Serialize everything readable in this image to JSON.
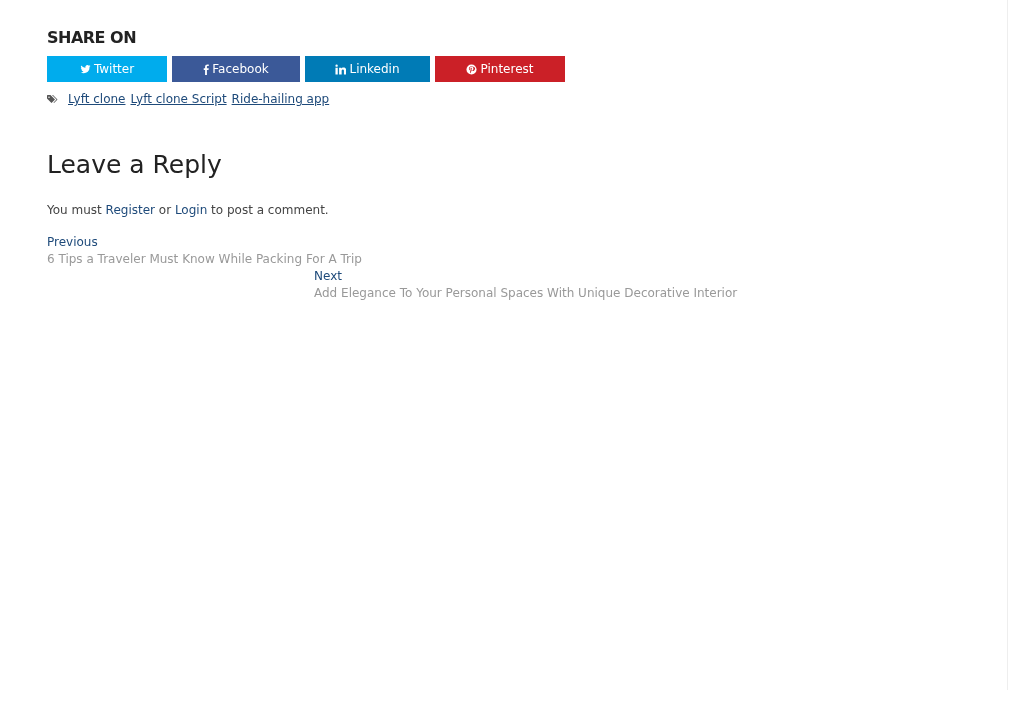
{
  "share": {
    "heading": "SHARE ON",
    "buttons": [
      {
        "kind": "twitter",
        "label": "Twitter",
        "color": "#00aced"
      },
      {
        "kind": "facebook",
        "label": "Facebook",
        "color": "#3b5998"
      },
      {
        "kind": "linkedin",
        "label": "Linkedin",
        "color": "#007bb6"
      },
      {
        "kind": "pinterest",
        "label": "Pinterest",
        "color": "#cb2027"
      }
    ]
  },
  "tags": [
    "Lyft clone",
    "Lyft clone Script",
    "Ride-hailing app"
  ],
  "reply": {
    "title": "Leave a Reply",
    "notice": {
      "before": "You must",
      "register": "Register",
      "middle": "or",
      "login": "Login",
      "after": "to post a comment."
    }
  },
  "post_nav": {
    "previous": {
      "label": "Previous",
      "title": "6 Tips a Traveler Must Know While Packing For A Trip"
    },
    "next": {
      "label": "Next",
      "title": "Add Elegance To Your Personal Spaces With Unique Decorative Interior"
    }
  }
}
